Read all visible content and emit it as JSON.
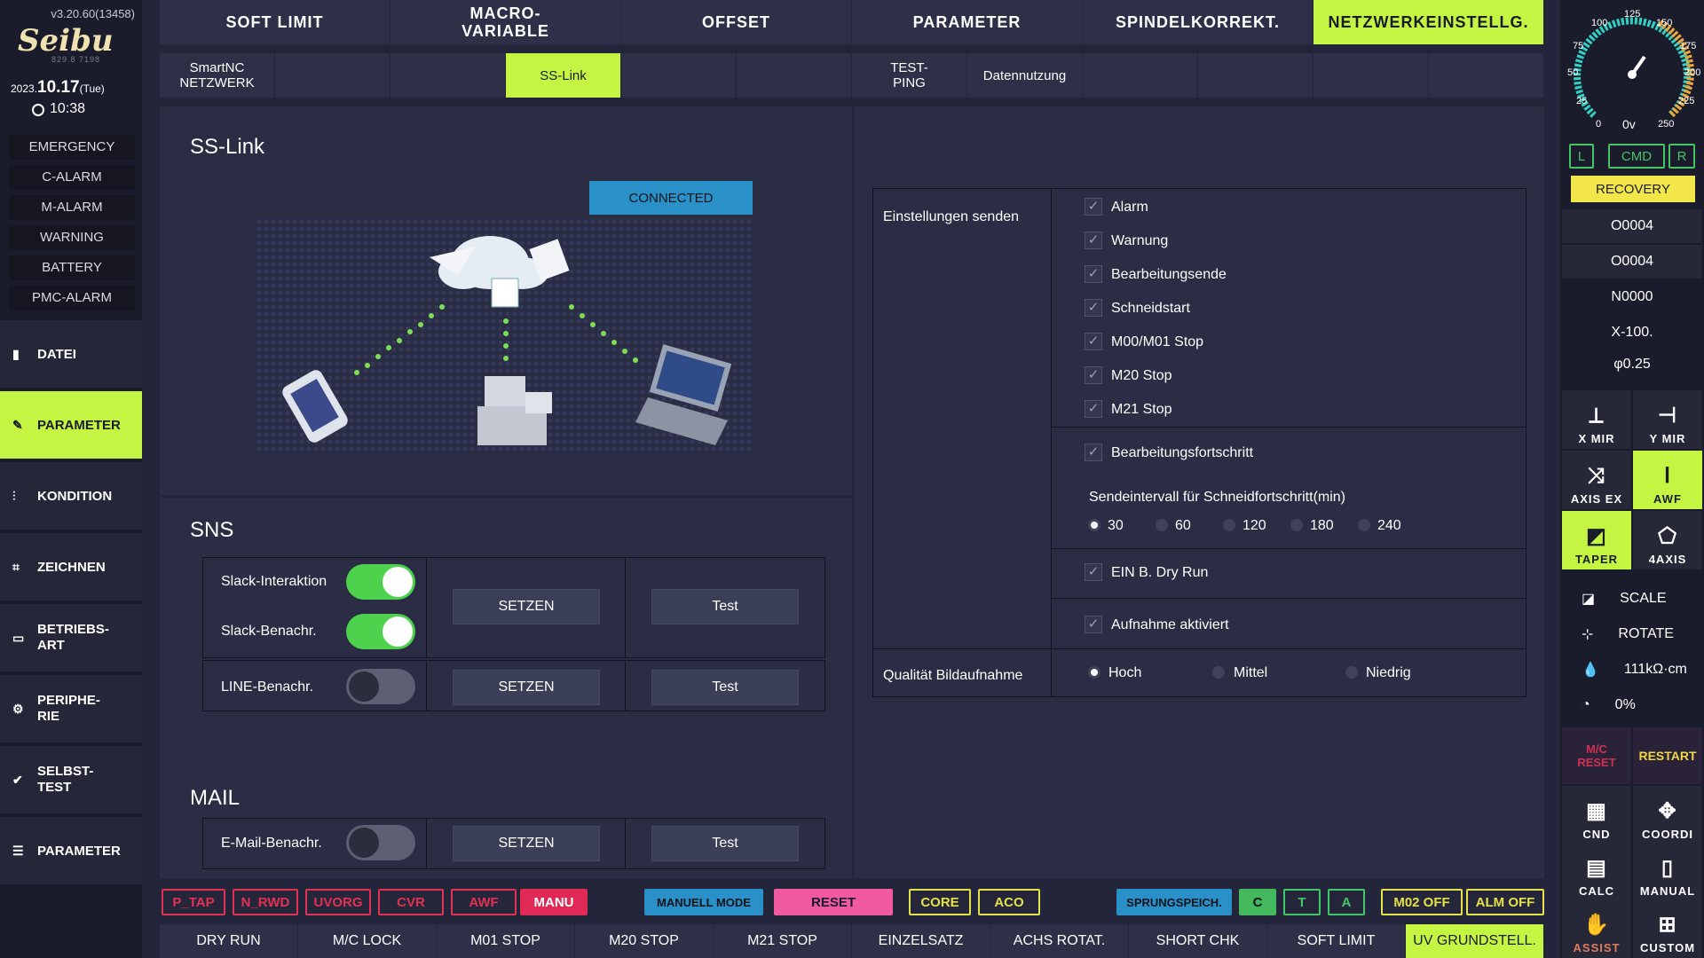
{
  "header": {
    "version": "v3.20.60(13458)",
    "logo": "Seibu",
    "logo_sub": "829.8     7198",
    "date_year": "2023.",
    "date_md": "10.17",
    "date_day": "(Tue)",
    "time": "10:38"
  },
  "alarms": [
    "EMERGENCY",
    "C-ALARM",
    "M-ALARM",
    "WARNING",
    "BATTERY",
    "PMC-ALARM"
  ],
  "nav": [
    {
      "label": "DATEI",
      "icon": "file-icon"
    },
    {
      "label": "PARAMETER",
      "icon": "wrench-icon",
      "selected": true
    },
    {
      "label": "KONDITION",
      "icon": "sliders-icon"
    },
    {
      "label": "ZEICHNEN",
      "icon": "draw-icon"
    },
    {
      "label": "BETRIEBS-\nART",
      "icon": "monitor-icon"
    },
    {
      "label": "PERIPHE-\nRIE",
      "icon": "gear-icon"
    },
    {
      "label": "SELBST-\nTEST",
      "icon": "check-icon"
    },
    {
      "label": "PARAMETER",
      "icon": "list-icon"
    }
  ],
  "tabs": [
    "SOFT LIMIT",
    "MACRO-\nVARIABLE",
    "OFFSET",
    "PARAMETER",
    "SPINDELKORREKT.",
    "NETZWERKEINSTELLG."
  ],
  "subtabs": [
    "SmartNC\nNETZWERK",
    "",
    "SS-Link",
    "",
    "",
    "TEST-\nPING",
    "Datennutzung",
    "",
    "",
    "",
    ""
  ],
  "sslink": {
    "title": "SS-Link",
    "status": "CONNECTED"
  },
  "sns": {
    "title": "SNS",
    "slack_interaction": "Slack-Interaktion",
    "slack_notify": "Slack-Benachr.",
    "line_notify": "LINE-Benachr.",
    "set_label": "SETZEN",
    "test_label": "Test"
  },
  "mail": {
    "title": "MAIL",
    "email_notify": "E-Mail-Benachr.",
    "set_label": "SETZEN",
    "test_label": "Test"
  },
  "settings": {
    "send_label": "Einstellungen senden",
    "items": [
      "Alarm",
      "Warnung",
      "Bearbeitungsende",
      "Schneidstart",
      "M00/M01 Stop",
      "M20 Stop",
      "M21 Stop"
    ],
    "progress": "Bearbeitungsfortschritt",
    "interval_label": "Sendeintervall für Schneidfortschritt(min)",
    "intervals": [
      "30",
      "60",
      "120",
      "180",
      "240"
    ],
    "dry_run": "EIN B. Dry Run",
    "recording": "Aufnahme aktiviert",
    "quality_label": "Qualität Bildaufnahme",
    "qualities": [
      "Hoch",
      "Mittel",
      "Niedrig"
    ]
  },
  "status_buttons": {
    "p_tap": "P_TAP",
    "n_rwd": "N_RWD",
    "uvorg": "UVORG",
    "cvr": "CVR",
    "awf": "AWF",
    "manu": "MANU",
    "manuell_mode": "MANUELL MODE",
    "reset": "RESET",
    "core": "CORE",
    "aco": "ACO",
    "sprungspeich": "SPRUNGSPEICH.",
    "c": "C",
    "t": "T",
    "a": "A",
    "m02off": "M02 OFF",
    "almoff": "ALM OFF"
  },
  "bottom": [
    "DRY RUN",
    "M/C LOCK",
    "M01 STOP",
    "M20 STOP",
    "M21 STOP",
    "EINZELSATZ",
    "ACHS ROTAT.",
    "SHORT CHK",
    "SOFT LIMIT",
    "UV GRUNDSTELL."
  ],
  "right": {
    "gauge": {
      "ticks": [
        "0",
        "25",
        "50",
        "75",
        "100",
        "125",
        "150",
        "175",
        "200",
        "225",
        "250"
      ],
      "value": "0v"
    },
    "l": "L",
    "cmd": "CMD",
    "r": "R",
    "recovery": "RECOVERY",
    "values": [
      "O0004",
      "O0004",
      "N0000",
      "X-100.",
      "φ0.25"
    ],
    "tools": [
      "X MIR",
      "Y MIR",
      "AXIS EX",
      "AWF",
      "TAPER",
      "4AXIS"
    ],
    "scale": "SCALE",
    "rotate": "ROTATE",
    "resist": "111kΩ·cm",
    "percent": "0%",
    "mc_reset": "M/C\nRESET",
    "restart": "RESTART",
    "cnd": "CND",
    "coordi": "COORDI",
    "calc": "CALC",
    "manual": "MANUAL",
    "assist": "ASSIST",
    "custom": "CUSTOM"
  }
}
